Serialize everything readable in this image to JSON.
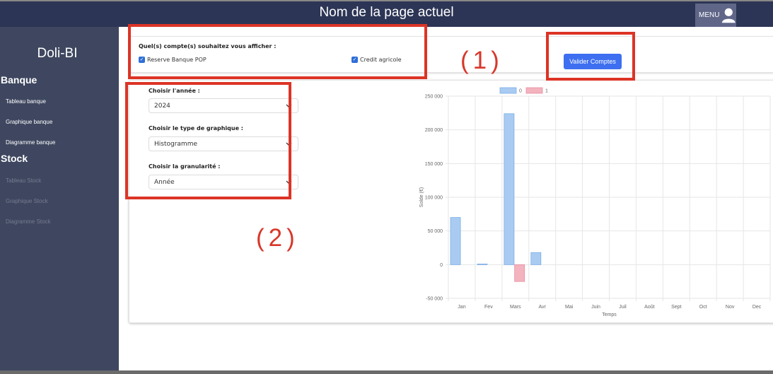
{
  "header": {
    "title": "Nom de la page actuel",
    "menu_label": "MENU"
  },
  "sidebar": {
    "brand": "Doli-BI",
    "sections": [
      {
        "title": "Banque",
        "items": [
          "Tableau banque",
          "Graphique banque",
          "Diagramme banque"
        ]
      },
      {
        "title": "Stock",
        "items": [
          "Tableau Stock",
          "Graphique Stock",
          "Diagramme Stock"
        ]
      }
    ]
  },
  "accounts": {
    "question": "Quel(s) compte(s) souhaitez vous afficher :",
    "options": [
      {
        "label": "Reserve Banque POP",
        "checked": true
      },
      {
        "label": "Credit agricole",
        "checked": true
      }
    ],
    "submit_label": "Valider Comptes"
  },
  "filters": {
    "year_label": "Choisir l'année :",
    "year_value": "2024",
    "type_label": "Choisir le type de graphique :",
    "type_value": "Histogramme",
    "granularity_label": "Choisir la granularité :",
    "granularity_value": "Année"
  },
  "annotations": {
    "a1": "(1)",
    "a2": "(2)"
  },
  "colors": {
    "accent": "#3d6ff0",
    "annotation": "#dc3426",
    "series0": "#a9cbf2",
    "series1": "#f3b3bf"
  },
  "chart_data": {
    "type": "bar",
    "categories": [
      "Jan",
      "Fev",
      "Mars",
      "Avr",
      "Mai",
      "Juin",
      "Juil",
      "Août",
      "Sept",
      "Oct",
      "Nov",
      "Dec"
    ],
    "series": [
      {
        "name": "0",
        "values": [
          70000,
          1000,
          224000,
          18000,
          0,
          0,
          0,
          0,
          0,
          0,
          0,
          0
        ]
      },
      {
        "name": "1",
        "values": [
          0,
          0,
          -25000,
          0,
          0,
          0,
          0,
          0,
          0,
          0,
          0,
          0
        ]
      }
    ],
    "yticks": [
      "-50 000",
      "0",
      "50 000",
      "100 000",
      "150 000",
      "200 000",
      "250 000"
    ],
    "ylim": [
      -50000,
      250000
    ],
    "xlabel": "Temps",
    "ylabel": "Solde (€)",
    "grid": true,
    "legend": "top"
  }
}
